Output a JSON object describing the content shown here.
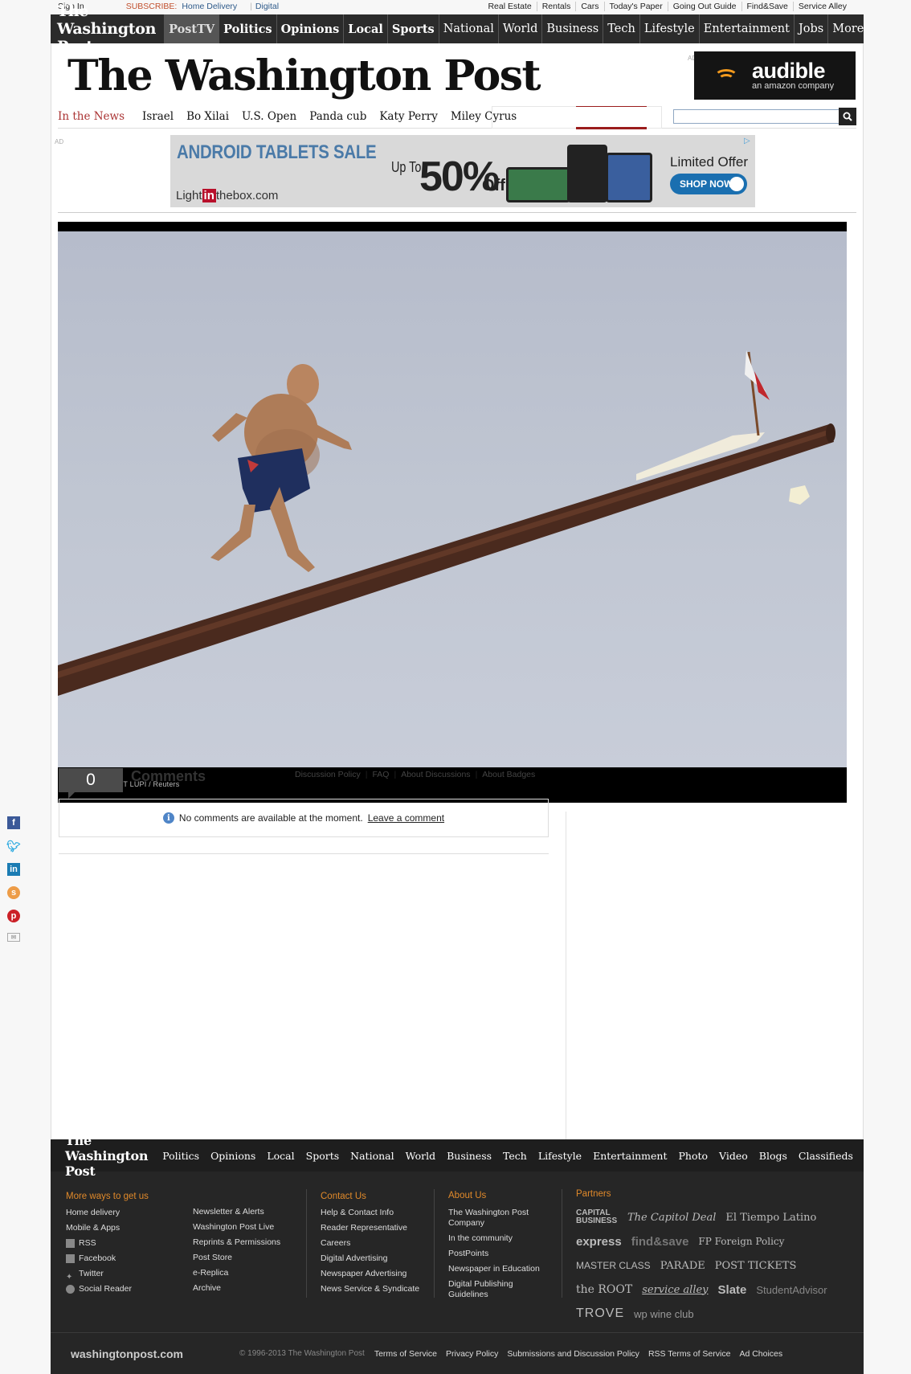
{
  "utility": {
    "sign_in": "Sign In",
    "subscribe": "SUBSCRIBE:",
    "home_delivery": "Home Delivery",
    "digital": "Digital",
    "right_links": [
      "Real Estate",
      "Rentals",
      "Cars",
      "Today's Paper",
      "Going Out Guide",
      "Find&Save",
      "Service Alley"
    ]
  },
  "topnav": {
    "brand": "The Washington Post",
    "items": [
      "PostTV",
      "Politics",
      "Opinions",
      "Local",
      "Sports",
      "National",
      "World",
      "Business",
      "Tech",
      "Lifestyle",
      "Entertainment",
      "Jobs",
      "More"
    ]
  },
  "masthead": "The Washington Post",
  "ad_label": "AD",
  "audible_ad": {
    "brand": "audible",
    "tagline": "an amazon company",
    "accent": "#f39a1d"
  },
  "in_the_news": {
    "label": "In the News",
    "topics": [
      "Israel",
      "Bo Xilai",
      "U.S. Open",
      "Panda cub",
      "Katy Perry",
      "Miley Cyrus"
    ]
  },
  "search": {
    "placeholder": "",
    "icon": "search-icon"
  },
  "banner_ad": {
    "headline": "ANDROID TABLETS SALE",
    "logo_pre": "Light",
    "logo_in": "in",
    "logo_post": "thebox.com",
    "up_to": "Up To",
    "percent": "50%",
    "off": "Off",
    "limited": "Limited Offer",
    "cta": "SHOP NOW"
  },
  "photo": {
    "credit": "DARRIN ZAMMIT LUPI / Reuters"
  },
  "comments": {
    "count": "0",
    "title": "Comments",
    "links": [
      "Discussion Policy",
      "FAQ",
      "About Discussions",
      "About Badges"
    ],
    "empty_message": "No comments are available at the moment.",
    "leave_comment": "Leave a comment"
  },
  "share": [
    "facebook-icon",
    "twitter-icon",
    "linkedin-icon",
    "stumbleupon-icon",
    "pinterest-icon",
    "email-icon"
  ],
  "footer": {
    "brand": "The Washington Post",
    "nav": [
      "Politics",
      "Opinions",
      "Local",
      "Sports",
      "National",
      "World",
      "Business",
      "Tech",
      "Lifestyle",
      "Entertainment",
      "Photo",
      "Video",
      "Blogs",
      "Classifieds"
    ],
    "more_ways": {
      "heading": "More ways to get us",
      "col1": [
        "Home delivery",
        "Mobile & Apps",
        "RSS",
        "Facebook",
        "Twitter",
        "Social Reader"
      ],
      "col2": [
        "Newsletter & Alerts",
        "Washington Post Live",
        "Reprints & Permissions",
        "Post Store",
        "e-Replica",
        "Archive"
      ]
    },
    "contact": {
      "heading": "Contact Us",
      "items": [
        "Help & Contact Info",
        "Reader Representative",
        "Careers",
        "Digital Advertising",
        "Newspaper Advertising",
        "News Service & Syndicate"
      ]
    },
    "about": {
      "heading": "About Us",
      "items": [
        "The Washington Post Company",
        "In the community",
        "PostPoints",
        "Newspaper in Education",
        "Digital Publishing Guidelines"
      ]
    },
    "partners": {
      "heading": "Partners",
      "rows": [
        [
          "CAPITAL BUSINESS",
          "The Capitol Deal",
          "El Tiempo Latino"
        ],
        [
          "express",
          "find&save",
          "FP Foreign Policy"
        ],
        [
          "MASTER CLASS",
          "PARADE",
          "POST TICKETS"
        ],
        [
          "the ROOT",
          "service alley",
          "Slate",
          "StudentAdvisor"
        ],
        [
          "TROVE",
          "wp wine club"
        ]
      ]
    },
    "site": "washingtonpost.com",
    "copyright": "© 1996-2013 The Washington Post",
    "bottom_links": [
      "Terms of Service",
      "Privacy Policy",
      "Submissions and Discussion Policy",
      "RSS Terms of Service",
      "Ad Choices"
    ]
  }
}
